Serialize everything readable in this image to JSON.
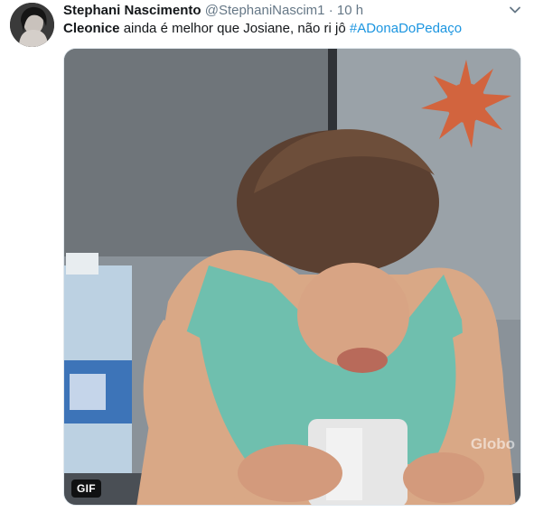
{
  "tweet": {
    "display_name": "Stephani Nascimento",
    "handle": "@StephaniNascim1",
    "separator": "·",
    "time": "10 h",
    "text_bold": "Cleonice",
    "text_body": " ainda é melhor que Josiane, não ri jô ",
    "hashtag": "#ADonaDoPedaço",
    "caret_icon": "chevron-down-icon"
  },
  "media": {
    "badge": "GIF",
    "watermark": "Globo"
  },
  "colors": {
    "link": "#1b95e0",
    "secondary_text": "#657786",
    "primary_text": "#14171a"
  }
}
